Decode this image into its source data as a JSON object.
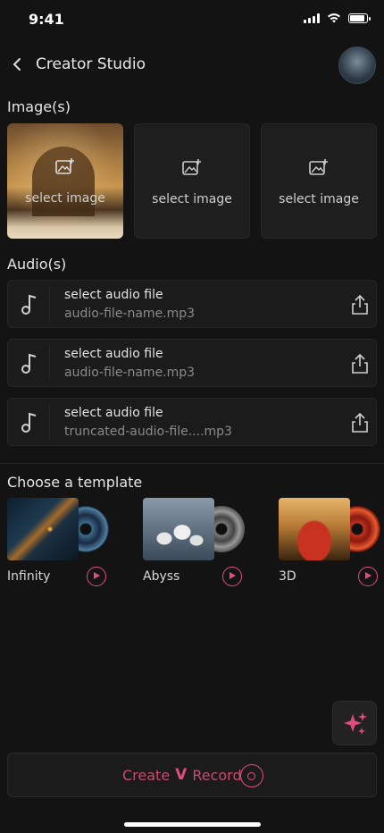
{
  "status": {
    "time": "9:41"
  },
  "header": {
    "title": "Creator Studio"
  },
  "images": {
    "label": "Image(s)",
    "slots": [
      {
        "label": "select image"
      },
      {
        "label": "select image"
      },
      {
        "label": "select image"
      }
    ]
  },
  "audios": {
    "label": "Audio(s)",
    "rows": [
      {
        "title": "select audio file",
        "file": "audio-file-name.mp3"
      },
      {
        "title": "select audio file",
        "file": "audio-file-name.mp3"
      },
      {
        "title": "select audio file",
        "file": "truncated-audio-file....mp3"
      }
    ]
  },
  "templates": {
    "label": "Choose a template",
    "items": [
      {
        "name": "Infinity"
      },
      {
        "name": "Abyss"
      },
      {
        "name": "3D"
      }
    ]
  },
  "create": {
    "text_left": "Create",
    "logo": "V",
    "text_right": "Record"
  },
  "colors": {
    "accent": "#e24c7a",
    "background": "#131313",
    "card": "#1e1e1e"
  }
}
